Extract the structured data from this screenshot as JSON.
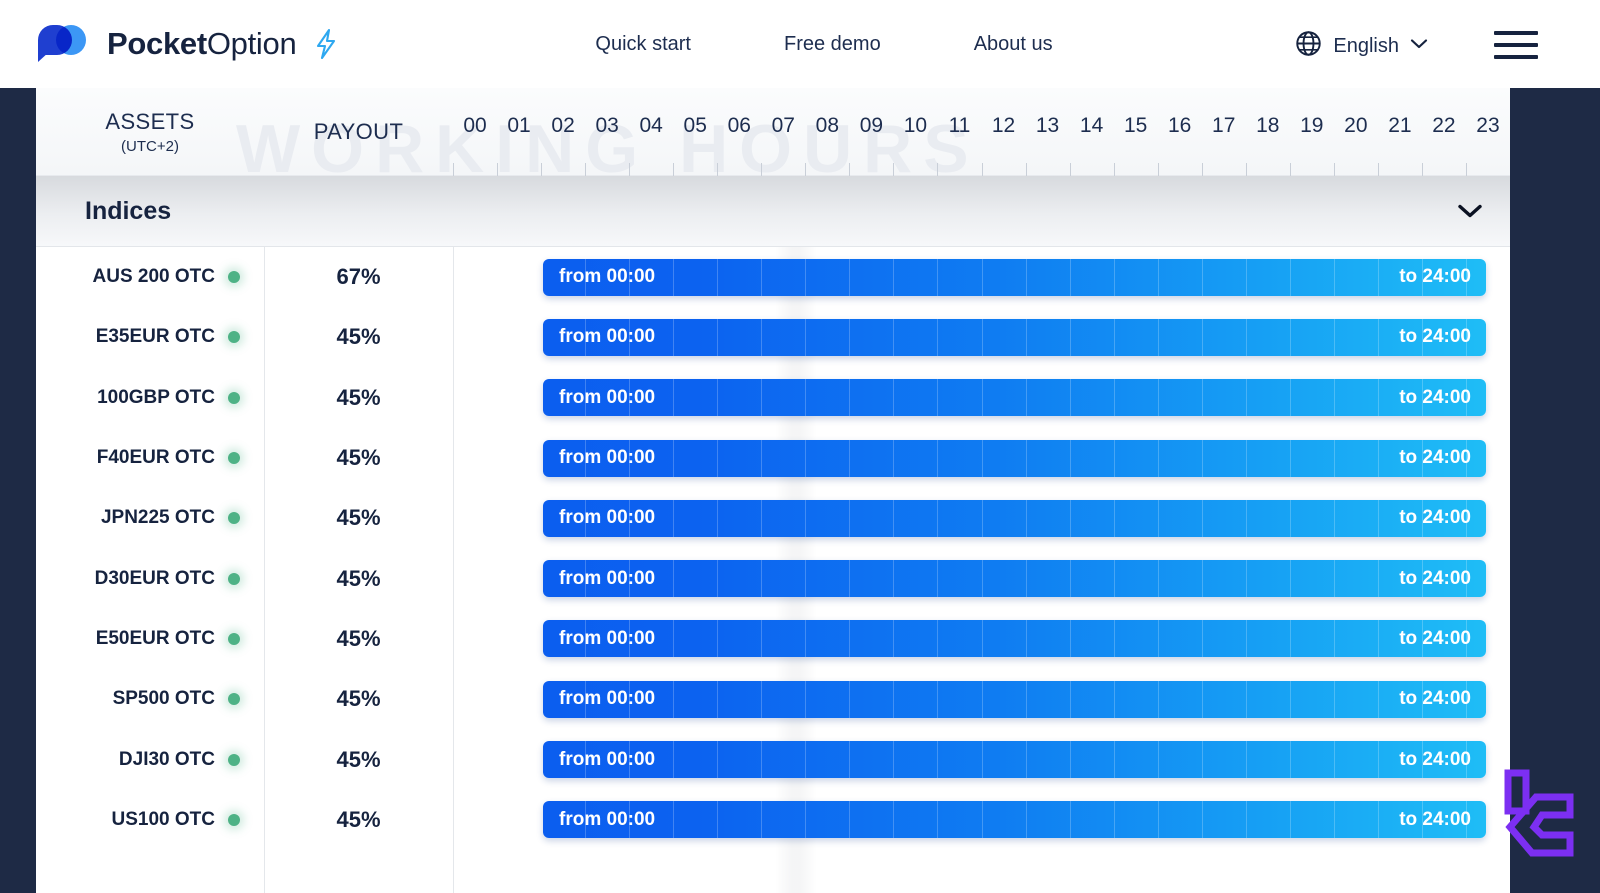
{
  "header": {
    "brand_bold": "Pocket",
    "brand_light": "Option",
    "bolt_icon": "lightning-bolt-icon",
    "nav": [
      {
        "label": "Quick start"
      },
      {
        "label": "Free demo"
      },
      {
        "label": "About us"
      }
    ],
    "language": {
      "icon": "globe-icon",
      "label": "English",
      "chevron": "chevron-down-icon"
    },
    "menu_icon": "hamburger-menu-icon"
  },
  "table": {
    "col_assets": "ASSETS",
    "col_assets_sub": "(UTC+2)",
    "col_payout": "PAYOUT",
    "watermark": "WORKING HOURS",
    "hours": [
      "00",
      "01",
      "02",
      "03",
      "04",
      "05",
      "06",
      "07",
      "08",
      "09",
      "10",
      "11",
      "12",
      "13",
      "14",
      "15",
      "16",
      "17",
      "18",
      "19",
      "20",
      "21",
      "22",
      "23"
    ]
  },
  "section": {
    "title": "Indices",
    "chevron": "chevron-down-icon"
  },
  "colors": {
    "page_bg": "#1e2a45",
    "bar_start": "#0b5eef",
    "bar_end": "#1fbdf6",
    "status_dot": "#4eb286",
    "text": "#16233f",
    "watermark_logo": "#7c2ff2"
  },
  "rows": [
    {
      "asset": "AUS 200 OTC",
      "status": "open",
      "payout": "67%",
      "from": "from 00:00",
      "to": "to 24:00"
    },
    {
      "asset": "E35EUR OTC",
      "status": "open",
      "payout": "45%",
      "from": "from 00:00",
      "to": "to 24:00"
    },
    {
      "asset": "100GBP OTC",
      "status": "open",
      "payout": "45%",
      "from": "from 00:00",
      "to": "to 24:00"
    },
    {
      "asset": "F40EUR OTC",
      "status": "open",
      "payout": "45%",
      "from": "from 00:00",
      "to": "to 24:00"
    },
    {
      "asset": "JPN225 OTC",
      "status": "open",
      "payout": "45%",
      "from": "from 00:00",
      "to": "to 24:00"
    },
    {
      "asset": "D30EUR OTC",
      "status": "open",
      "payout": "45%",
      "from": "from 00:00",
      "to": "to 24:00"
    },
    {
      "asset": "E50EUR OTC",
      "status": "open",
      "payout": "45%",
      "from": "from 00:00",
      "to": "to 24:00"
    },
    {
      "asset": "SP500 OTC",
      "status": "open",
      "payout": "45%",
      "from": "from 00:00",
      "to": "to 24:00"
    },
    {
      "asset": "DJI30 OTC",
      "status": "open",
      "payout": "45%",
      "from": "from 00:00",
      "to": "to 24:00"
    },
    {
      "asset": "US100 OTC",
      "status": "open",
      "payout": "45%",
      "from": "from 00:00",
      "to": "to 24:00"
    }
  ],
  "corner_watermark": {
    "icon": "bracket-logo-watermark"
  }
}
